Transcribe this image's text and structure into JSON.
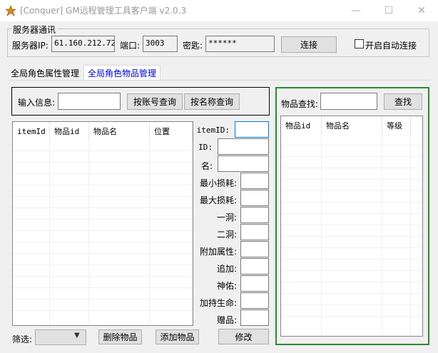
{
  "window": {
    "title": "[Conquer] GM远程管理工具客户端 v2.0.3",
    "minimize_glyph": "—",
    "maximize_glyph": "☐",
    "close_glyph": "✕"
  },
  "server_group": {
    "legend": "服务器通讯",
    "ip_label": "服务器IP:",
    "ip_value": "61.160.212.72",
    "port_label": "端口:",
    "port_value": "3003",
    "key_label": "密匙:",
    "key_value": "******",
    "connect_label": "连接",
    "autoconnect_label": "开启自动连接"
  },
  "tabs": [
    {
      "label": "全局角色属性管理"
    },
    {
      "label": "全局角色物品管理"
    }
  ],
  "query": {
    "input_label": "输入信息:",
    "input_value": "",
    "by_account_label": "按账号查询",
    "by_name_label": "按名称查询"
  },
  "item_list": {
    "columns": [
      "itemId",
      "物品id",
      "物品名",
      "位置"
    ]
  },
  "fields": [
    {
      "label": "itemID:"
    },
    {
      "label": "ID:"
    },
    {
      "label": "名:"
    },
    {
      "label": "最小损耗:"
    },
    {
      "label": "最大损耗:"
    },
    {
      "label": "一洞:"
    },
    {
      "label": "二洞:"
    },
    {
      "label": "附加属性:"
    },
    {
      "label": "追加:"
    },
    {
      "label": "神佑:"
    },
    {
      "label": "加持生命:"
    },
    {
      "label": "赠品:"
    }
  ],
  "bottom": {
    "filter_label": "筛选:",
    "filter_value": "",
    "delete_label": "删除物品",
    "add_label": "添加物品",
    "modify_label": "修改"
  },
  "item_search": {
    "label": "物品查找:",
    "value": "",
    "button_label": "查找",
    "columns": [
      "物品id",
      "物品名",
      "等级"
    ]
  },
  "colors": {
    "green_frame": "#2a8a2a",
    "active_tab_text": "#0000cc",
    "focus_border": "#0078d7"
  }
}
